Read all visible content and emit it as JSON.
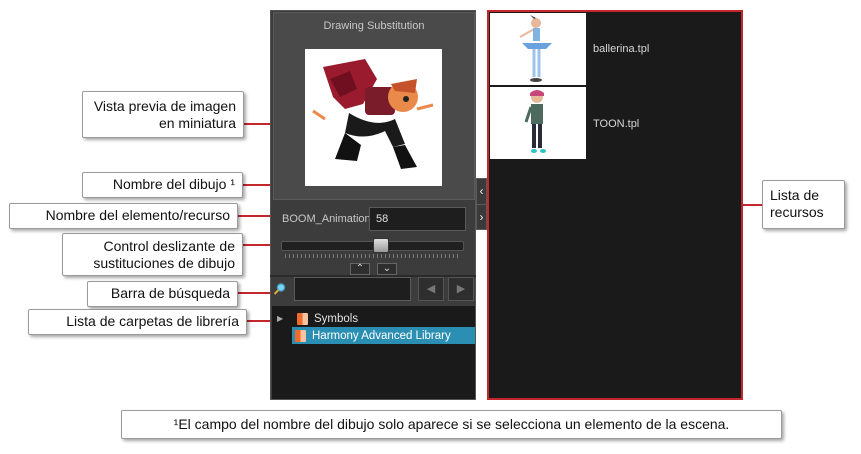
{
  "panel": {
    "title": "Drawing Substitution",
    "element_name": "BOOM_Animation",
    "drawing_name": "58",
    "slider_level": 0.55,
    "thumbnail": "character-thumbnail-image"
  },
  "search": {
    "placeholder": ""
  },
  "library_tree": [
    {
      "label": "Symbols",
      "icon": "folder-icon",
      "selected": false
    },
    {
      "label": "Harmony Advanced Library",
      "icon": "folder-icon",
      "selected": true
    }
  ],
  "templates": [
    {
      "label": "ballerina.tpl",
      "thumbnail": "ballerina-thumbnail"
    },
    {
      "label": "TOON.tpl",
      "thumbnail": "toon-thumbnail"
    }
  ],
  "callouts": {
    "thumbnail_preview": "Vista previa de imagen en miniatura",
    "drawing_name": "Nombre del dibujo ¹",
    "element_name": "Nombre del elemento/recurso",
    "slider": "Control deslizante de sustituciones de dibujo",
    "search_bar": "Barra de búsqueda",
    "folder_list": "Lista de carpetas de librería",
    "resource_list": "Lista de recursos"
  },
  "footnote": "¹El campo del nombre del dibujo solo aparece si se selecciona un elemento de la escena.",
  "colors": {
    "accent_red": "#c4262e",
    "selection_blue": "#2a8fb3",
    "panel_dark": "#1a1a1a"
  }
}
